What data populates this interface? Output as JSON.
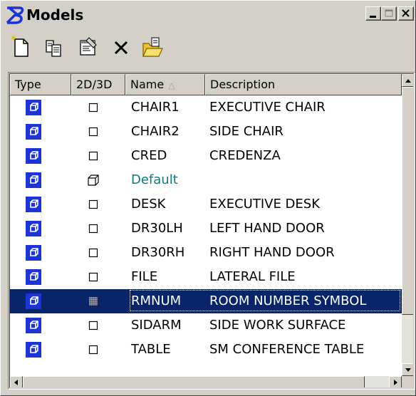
{
  "window": {
    "title": "Models"
  },
  "toolbar": {
    "buttons": [
      {
        "name": "new-model-button",
        "icon": "new-document-icon"
      },
      {
        "name": "copy-model-button",
        "icon": "copy-icon"
      },
      {
        "name": "model-properties-button",
        "icon": "properties-icon"
      },
      {
        "name": "delete-model-button",
        "icon": "delete-x-icon"
      },
      {
        "name": "import-model-button",
        "icon": "open-folder-icon"
      }
    ]
  },
  "columns": [
    {
      "label": "Type"
    },
    {
      "label": "2D/3D"
    },
    {
      "label": "Name",
      "sort": "ascending"
    },
    {
      "label": "Description"
    }
  ],
  "rows": [
    {
      "name": "CHAIR1",
      "description": "EXECUTIVE CHAIR",
      "dim": "2D"
    },
    {
      "name": "CHAIR2",
      "description": "SIDE CHAIR",
      "dim": "2D"
    },
    {
      "name": "CRED",
      "description": "CREDENZA",
      "dim": "2D"
    },
    {
      "name": "Default",
      "description": "",
      "dim": "3D",
      "color": "#0f7a7a"
    },
    {
      "name": "DESK",
      "description": "EXECUTIVE DESK",
      "dim": "2D"
    },
    {
      "name": "DR30LH",
      "description": "LEFT HAND DOOR",
      "dim": "2D"
    },
    {
      "name": "DR30RH",
      "description": "RIGHT HAND DOOR",
      "dim": "2D"
    },
    {
      "name": "FILE",
      "description": "LATERAL FILE",
      "dim": "2D"
    },
    {
      "name": "RMNUM",
      "description": "ROOM NUMBER SYMBOL",
      "dim": "2D",
      "selected": true
    },
    {
      "name": "SIDARM",
      "description": "SIDE WORK SURFACE",
      "dim": "2D"
    },
    {
      "name": "TABLE",
      "description": "SM CONFERENCE TABLE",
      "dim": "2D"
    }
  ],
  "colors": {
    "selection": "#0a246a",
    "type_icon": "#1c34d6",
    "active_model": "#0f7a7a"
  }
}
